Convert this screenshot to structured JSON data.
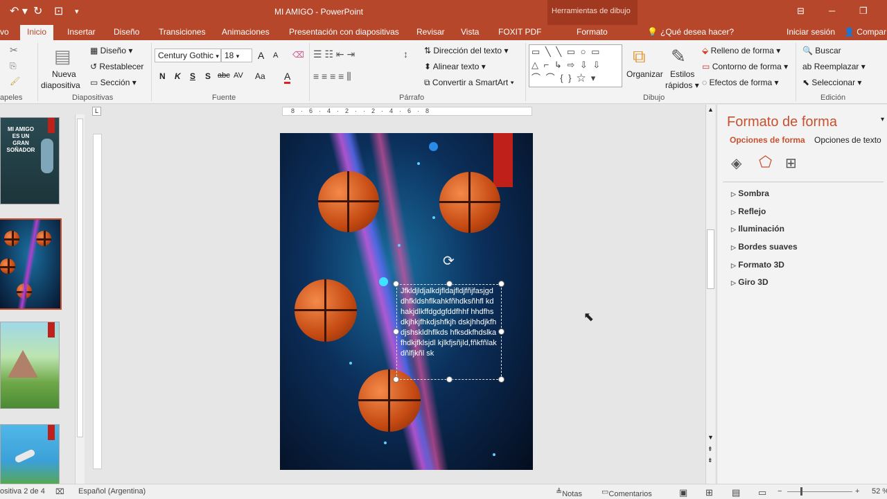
{
  "titlebar": {
    "title": "MI AMIGO - PowerPoint",
    "contextual": "Herramientas de dibujo",
    "undo": "↶ ▾",
    "redo": "↻",
    "customize": "▾"
  },
  "tabs": [
    {
      "label": "vo"
    },
    {
      "label": "Inicio"
    },
    {
      "label": "Insertar"
    },
    {
      "label": "Diseño"
    },
    {
      "label": "Transiciones"
    },
    {
      "label": "Animaciones"
    },
    {
      "label": "Presentación con diapositivas"
    },
    {
      "label": "Revisar"
    },
    {
      "label": "Vista"
    },
    {
      "label": "FOXIT PDF"
    },
    {
      "label": "Formato"
    }
  ],
  "tell_me": "¿Qué desea hacer?",
  "sign_in": "Iniciar sesión",
  "share": "Compar",
  "ribbon": {
    "clipboard_group": "apeles",
    "slides": {
      "new_slide": "Nueva",
      "new_slide2": "diapositiva",
      "layout": "Diseño",
      "reset": "Restablecer",
      "section": "Sección",
      "group": "Diapositivas"
    },
    "font": {
      "name": "Century Gothic",
      "size": "18",
      "bold": "N",
      "italic": "K",
      "underline": "S",
      "shadow": "S",
      "strike": "abc",
      "spacing": "AV",
      "case": "Aa",
      "color": "A",
      "grow": "A",
      "shrink": "A",
      "group": "Fuente"
    },
    "paragraph": {
      "direction": "Dirección del texto",
      "align": "Alinear texto",
      "smartart": "Convertir a SmartArt",
      "group": "Párrafo"
    },
    "drawing": {
      "shapes_glyphs": [
        "▭ ╲ ╲ ▭ ○ ▭",
        "△ ⌐ ↳ ⇨ ⇩ ⇩",
        "⌒ ⌒ { } ☆ ▾"
      ],
      "arrange": "Organizar",
      "quick_styles": "Estilos",
      "quick_styles2": "rápidos",
      "fill": "Relleno de forma",
      "outline": "Contorno de forma",
      "effects": "Efectos de forma",
      "group": "Dibujo"
    },
    "editing": {
      "find": "Buscar",
      "replace": "Reemplazar",
      "select": "Seleccionar",
      "group": "Edición"
    }
  },
  "thumb1_text": "MI AMIGO ES UN GRAN SOÑADOR",
  "textbox_text": "Jfkldjldjalkdjfldajfldjfñjfasjgd dhfkldshflkahkfñhdksñhfl kdhakjdlkffdgdgfddfhhf hhdfhsdkjhkjfhkdjshfkjh dskjhhdjkfhdjshskldhflkds hfksdkfhdslkafhdkjfklsjdl kjlkfjsñjld,fñkfñlakdñlfjkñl sk",
  "format_panel": {
    "title": "Formato de forma",
    "shape_options": "Opciones de forma",
    "text_options": "Opciones de texto",
    "sections": [
      "Sombra",
      "Reflejo",
      "Iluminación",
      "Bordes suaves",
      "Formato 3D",
      "Giro 3D"
    ]
  },
  "status": {
    "slide": "ositiva 2 de 4",
    "language": "Español (Argentina)",
    "notes": "Notas",
    "comments": "Comentarios",
    "zoom": "52 %"
  },
  "colors": {
    "accent": "#b7472a",
    "panel_title": "#c8502f"
  }
}
